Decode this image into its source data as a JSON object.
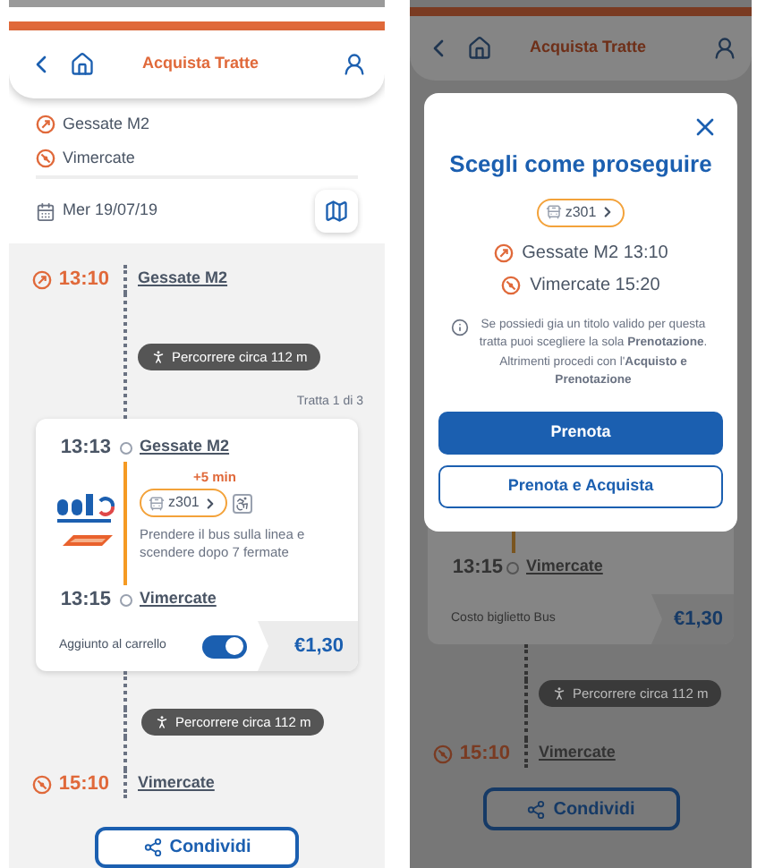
{
  "left": {
    "header": {
      "title": "Acquista Tratte"
    },
    "from": "Gessate M2",
    "to": "Vimercate",
    "date": "Mer 19/07/19",
    "departure": {
      "time": "13:10",
      "place": "Gessate M2"
    },
    "walk_1": "Percorrere circa 112 m",
    "leg_counter": "Tratta 1 di 3",
    "leg": {
      "start_time": "13:13",
      "start_stop": "Gessate M2",
      "delay": "+5 min",
      "line": "z301",
      "accessible": true,
      "instructions": "Prendere il bus sulla linea e scendere dopo 7 fermate",
      "end_time": "13:15",
      "end_stop": "Vimercate",
      "cart_label": "Aggiunto al carrello",
      "in_cart": true,
      "price": "€1,30"
    },
    "walk_2": "Percorrere circa 112 m",
    "arrival": {
      "time": "15:10",
      "place": "Vimercate"
    },
    "share": "Condividi"
  },
  "right": {
    "header": {
      "title": "Acquista Tratte"
    },
    "dialog": {
      "title": "Scegli come proseguire",
      "line": "z301",
      "from": "Gessate M2 13:10",
      "to": "Vimercate 15:20",
      "info": "Se possiedi gia un titolo valido per questa tratta puoi scegliere la sola **Prenotazione**. Altrimenti procedi con l'**Acquisto e Prenotazione**",
      "buttons": [
        {
          "label": "Prenota",
          "kind": "primary"
        },
        {
          "label": "Prenota e Acquista",
          "kind": "secondary"
        }
      ]
    },
    "leg": {
      "end_time": "13:15",
      "end_stop": "Vimercate",
      "cost_label": "Costo biglietto Bus",
      "price": "€1,30"
    },
    "walk": "Percorrere circa 112 m",
    "arrival": {
      "time": "15:10",
      "place": "Vimercate"
    },
    "share": "Condividi"
  }
}
